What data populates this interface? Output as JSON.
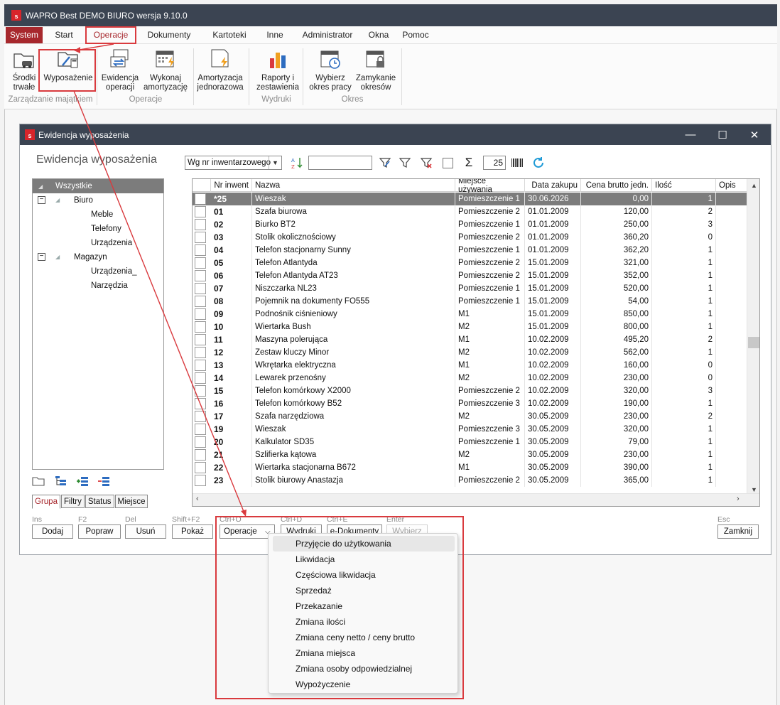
{
  "app": {
    "title": "WAPRO Best DEMO BIURO wersja 9.10.0",
    "logo": "s"
  },
  "menu": [
    "System",
    "Start",
    "Operacje",
    "Dokumenty",
    "Kartoteki",
    "Inne",
    "Administrator",
    "Okna",
    "Pomoc"
  ],
  "ribbon": {
    "buttons": [
      {
        "label1": "Środki",
        "label2": "trwałe",
        "icon": "folder-car-icon"
      },
      {
        "label1": "Wyposażenie",
        "label2": "",
        "icon": "folder-calculator-icon"
      },
      {
        "label1": "Ewidencja",
        "label2": "operacji",
        "icon": "arrows-screen-icon"
      },
      {
        "label1": "Wykonaj",
        "label2": "amortyzację",
        "icon": "calendar-lightning-icon"
      },
      {
        "label1": "Amortyzacja",
        "label2": "jednorazowa",
        "icon": "lightning-doc-icon"
      },
      {
        "label1": "Raporty i",
        "label2": "zestawienia",
        "icon": "bar-chart-icon"
      },
      {
        "label1": "Wybierz",
        "label2": "okres pracy",
        "icon": "calendar-clock-icon"
      },
      {
        "label1": "Zamykanie",
        "label2": "okresów",
        "icon": "calendar-lock-icon"
      }
    ],
    "groups": [
      "Zarządzanie majątkiem",
      "Operacje",
      "Wydruki",
      "Okres"
    ]
  },
  "window": {
    "title": "Ewidencja wyposażenia",
    "heading": "Ewidencja wyposażenia",
    "sort_combo": "Wg nr inwentarzowego",
    "page_size": "25",
    "controls": {
      "minimize": "—",
      "maximize": "☐",
      "close": "✕"
    }
  },
  "tree": {
    "root": "Wszystkie",
    "groups": [
      {
        "label": "Biuro",
        "children": [
          "Meble",
          "Telefony",
          "Urządzenia"
        ]
      },
      {
        "label": "Magazyn",
        "children": [
          "Urządzenia_",
          "Narzędzia"
        ]
      }
    ],
    "expander": "−",
    "tabs": [
      "Grupa",
      "Filtry",
      "Status",
      "Miejsce"
    ]
  },
  "grid": {
    "columns": [
      "Nr inwent",
      "Nazwa",
      "Miejsce używania",
      "Data zakupu",
      "Cena brutto jedn.",
      "Ilość",
      "Opis"
    ],
    "rows": [
      [
        "*25",
        "Wieszak",
        "Pomieszczenie 1",
        "30.06.2026",
        "0,00",
        "1"
      ],
      [
        "01",
        "Szafa biurowa",
        "Pomieszczenie 2",
        "01.01.2009",
        "120,00",
        "2"
      ],
      [
        "02",
        "Biurko BT2",
        "Pomieszczenie 1",
        "01.01.2009",
        "250,00",
        "3"
      ],
      [
        "03",
        "Stolik okolicznościowy",
        "Pomieszczenie 2",
        "01.01.2009",
        "360,20",
        "0"
      ],
      [
        "04",
        "Telefon stacjonarny Sunny",
        "Pomieszczenie 1",
        "01.01.2009",
        "362,20",
        "1"
      ],
      [
        "05",
        "Telefon Atlantyda",
        "Pomieszczenie 2",
        "15.01.2009",
        "321,00",
        "1"
      ],
      [
        "06",
        "Telefon  Atlantyda AT23",
        "Pomieszczenie 2",
        "15.01.2009",
        "352,00",
        "1"
      ],
      [
        "07",
        "Niszczarka NL23",
        "Pomieszczenie 1",
        "15.01.2009",
        "520,00",
        "1"
      ],
      [
        "08",
        "Pojemnik na dokumenty FO555",
        "Pomieszczenie 1",
        "15.01.2009",
        "54,00",
        "1"
      ],
      [
        "09",
        "Podnośnik ciśnieniowy",
        "M1",
        "15.01.2009",
        "850,00",
        "1"
      ],
      [
        "10",
        "Wiertarka Bush",
        "M2",
        "15.01.2009",
        "800,00",
        "1"
      ],
      [
        "11",
        "Maszyna polerująca",
        "M1",
        "10.02.2009",
        "495,20",
        "2"
      ],
      [
        "12",
        "Zestaw kluczy Minor",
        "M2",
        "10.02.2009",
        "562,00",
        "1"
      ],
      [
        "13",
        "Wkrętarka elektryczna",
        "M1",
        "10.02.2009",
        "160,00",
        "0"
      ],
      [
        "14",
        "Lewarek przenośny",
        "M2",
        "10.02.2009",
        "230,00",
        "0"
      ],
      [
        "15",
        "Telefon komórkowy X2000",
        "Pomieszczenie 2",
        "10.02.2009",
        "320,00",
        "3"
      ],
      [
        "16",
        "Telefon komórkowy B52",
        "Pomieszczenie 3",
        "10.02.2009",
        "190,00",
        "1"
      ],
      [
        "17",
        "Szafa narzędziowa",
        "M2",
        "30.05.2009",
        "230,00",
        "2"
      ],
      [
        "19",
        "Wieszak",
        "Pomieszczenie 3",
        "30.05.2009",
        "320,00",
        "1"
      ],
      [
        "20",
        "Kalkulator SD35",
        "Pomieszczenie 1",
        "30.05.2009",
        "79,00",
        "1"
      ],
      [
        "21",
        "Szlifierka kątowa",
        "M2",
        "30.05.2009",
        "230,00",
        "1"
      ],
      [
        "22",
        "Wiertarka stacjonarna B672",
        "M1",
        "30.05.2009",
        "390,00",
        "1"
      ],
      [
        "23",
        "Stolik biurowy Anastazja",
        "Pomieszczenie 2",
        "30.05.2009",
        "365,00",
        "1"
      ]
    ]
  },
  "actions": [
    {
      "shortcut": "Ins",
      "label": "Dodaj"
    },
    {
      "shortcut": "F2",
      "label": "Popraw"
    },
    {
      "shortcut": "Del",
      "label": "Usuń"
    },
    {
      "shortcut": "Shift+F2",
      "label": "Pokaż"
    },
    {
      "shortcut": "Ctrl+O",
      "label": "Operacje",
      "arrow": "⌵"
    },
    {
      "shortcut": "Ctrl+D",
      "label": "Wydruki"
    },
    {
      "shortcut": "Ctrl+E",
      "label": "e-Dokumenty"
    },
    {
      "shortcut": "Enter",
      "label": "Wybierz"
    },
    {
      "shortcut": "Esc",
      "label": "Zamknij"
    }
  ],
  "popup_menu": [
    "Przyjęcie do użytkowania",
    "Likwidacja",
    "Częściowa likwidacja",
    "Sprzedaż",
    "Przekazanie",
    "Zmiana ilości",
    "Zmiana ceny netto / ceny brutto",
    "Zmiana miejsca",
    "Zmiana osoby odpowiedzialnej",
    "Wypożyczenie"
  ],
  "colors": {
    "accent": "#a7282d",
    "titlebar": "#3b4452",
    "highlight": "#d93a3e",
    "selected_row": "#7c7c7c"
  }
}
